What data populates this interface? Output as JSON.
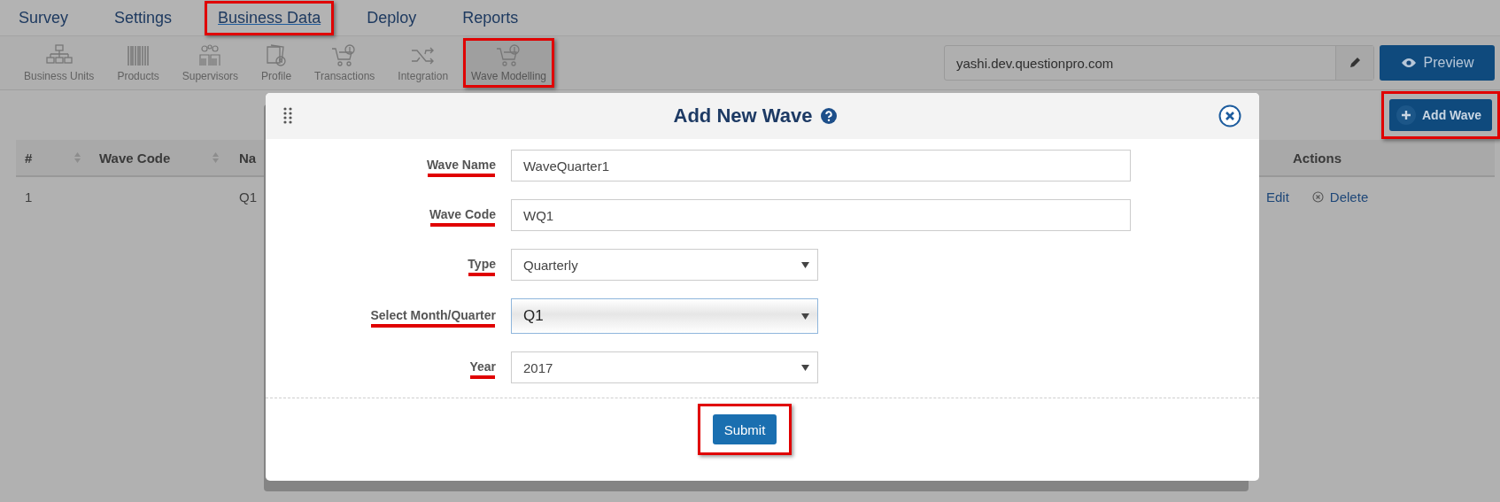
{
  "top_nav": [
    {
      "label": "Survey",
      "selected": false,
      "highlighted": false
    },
    {
      "label": "Settings",
      "selected": false,
      "highlighted": false
    },
    {
      "label": "Business Data",
      "selected": true,
      "highlighted": true
    },
    {
      "label": "Deploy",
      "selected": false,
      "highlighted": false
    },
    {
      "label": "Reports",
      "selected": false,
      "highlighted": false
    }
  ],
  "sub_nav": [
    {
      "label": "Business Units",
      "selected": false,
      "highlighted": false
    },
    {
      "label": "Products",
      "selected": false,
      "highlighted": false
    },
    {
      "label": "Supervisors",
      "selected": false,
      "highlighted": false
    },
    {
      "label": "Profile",
      "selected": false,
      "highlighted": false
    },
    {
      "label": "Transactions",
      "selected": false,
      "highlighted": false
    },
    {
      "label": "Integration",
      "selected": false,
      "highlighted": false
    },
    {
      "label": "Wave Modelling",
      "selected": true,
      "highlighted": true
    }
  ],
  "domain_field": {
    "value": "yashi.dev.questionpro.com"
  },
  "preview_button": {
    "label": "Preview"
  },
  "add_button": {
    "label": "Add Wave",
    "highlighted": true
  },
  "table": {
    "columns": [
      "#",
      "Wave Code",
      "Na",
      "Actions"
    ],
    "rows": [
      {
        "cells": [
          "1",
          "",
          "Q1"
        ],
        "actions": [
          "Edit",
          "Delete"
        ]
      }
    ]
  },
  "dialog": {
    "title": "Add New Wave",
    "fields": [
      {
        "label": "Wave Name",
        "kind": "text",
        "value": "WaveQuarter1",
        "underlined": true,
        "focused": false
      },
      {
        "label": "Wave Code",
        "kind": "text",
        "value": "WQ1",
        "underlined": true,
        "focused": false
      },
      {
        "label": "Type",
        "kind": "select",
        "value": "Quarterly",
        "underlined": true,
        "focused": false
      },
      {
        "label": "Select Month/Quarter",
        "kind": "select",
        "value": "Q1",
        "underlined": true,
        "focused": true
      },
      {
        "label": "Year",
        "kind": "select",
        "value": "2017",
        "underlined": true,
        "focused": false
      }
    ],
    "submit": {
      "label": "Submit",
      "highlighted": true
    }
  }
}
